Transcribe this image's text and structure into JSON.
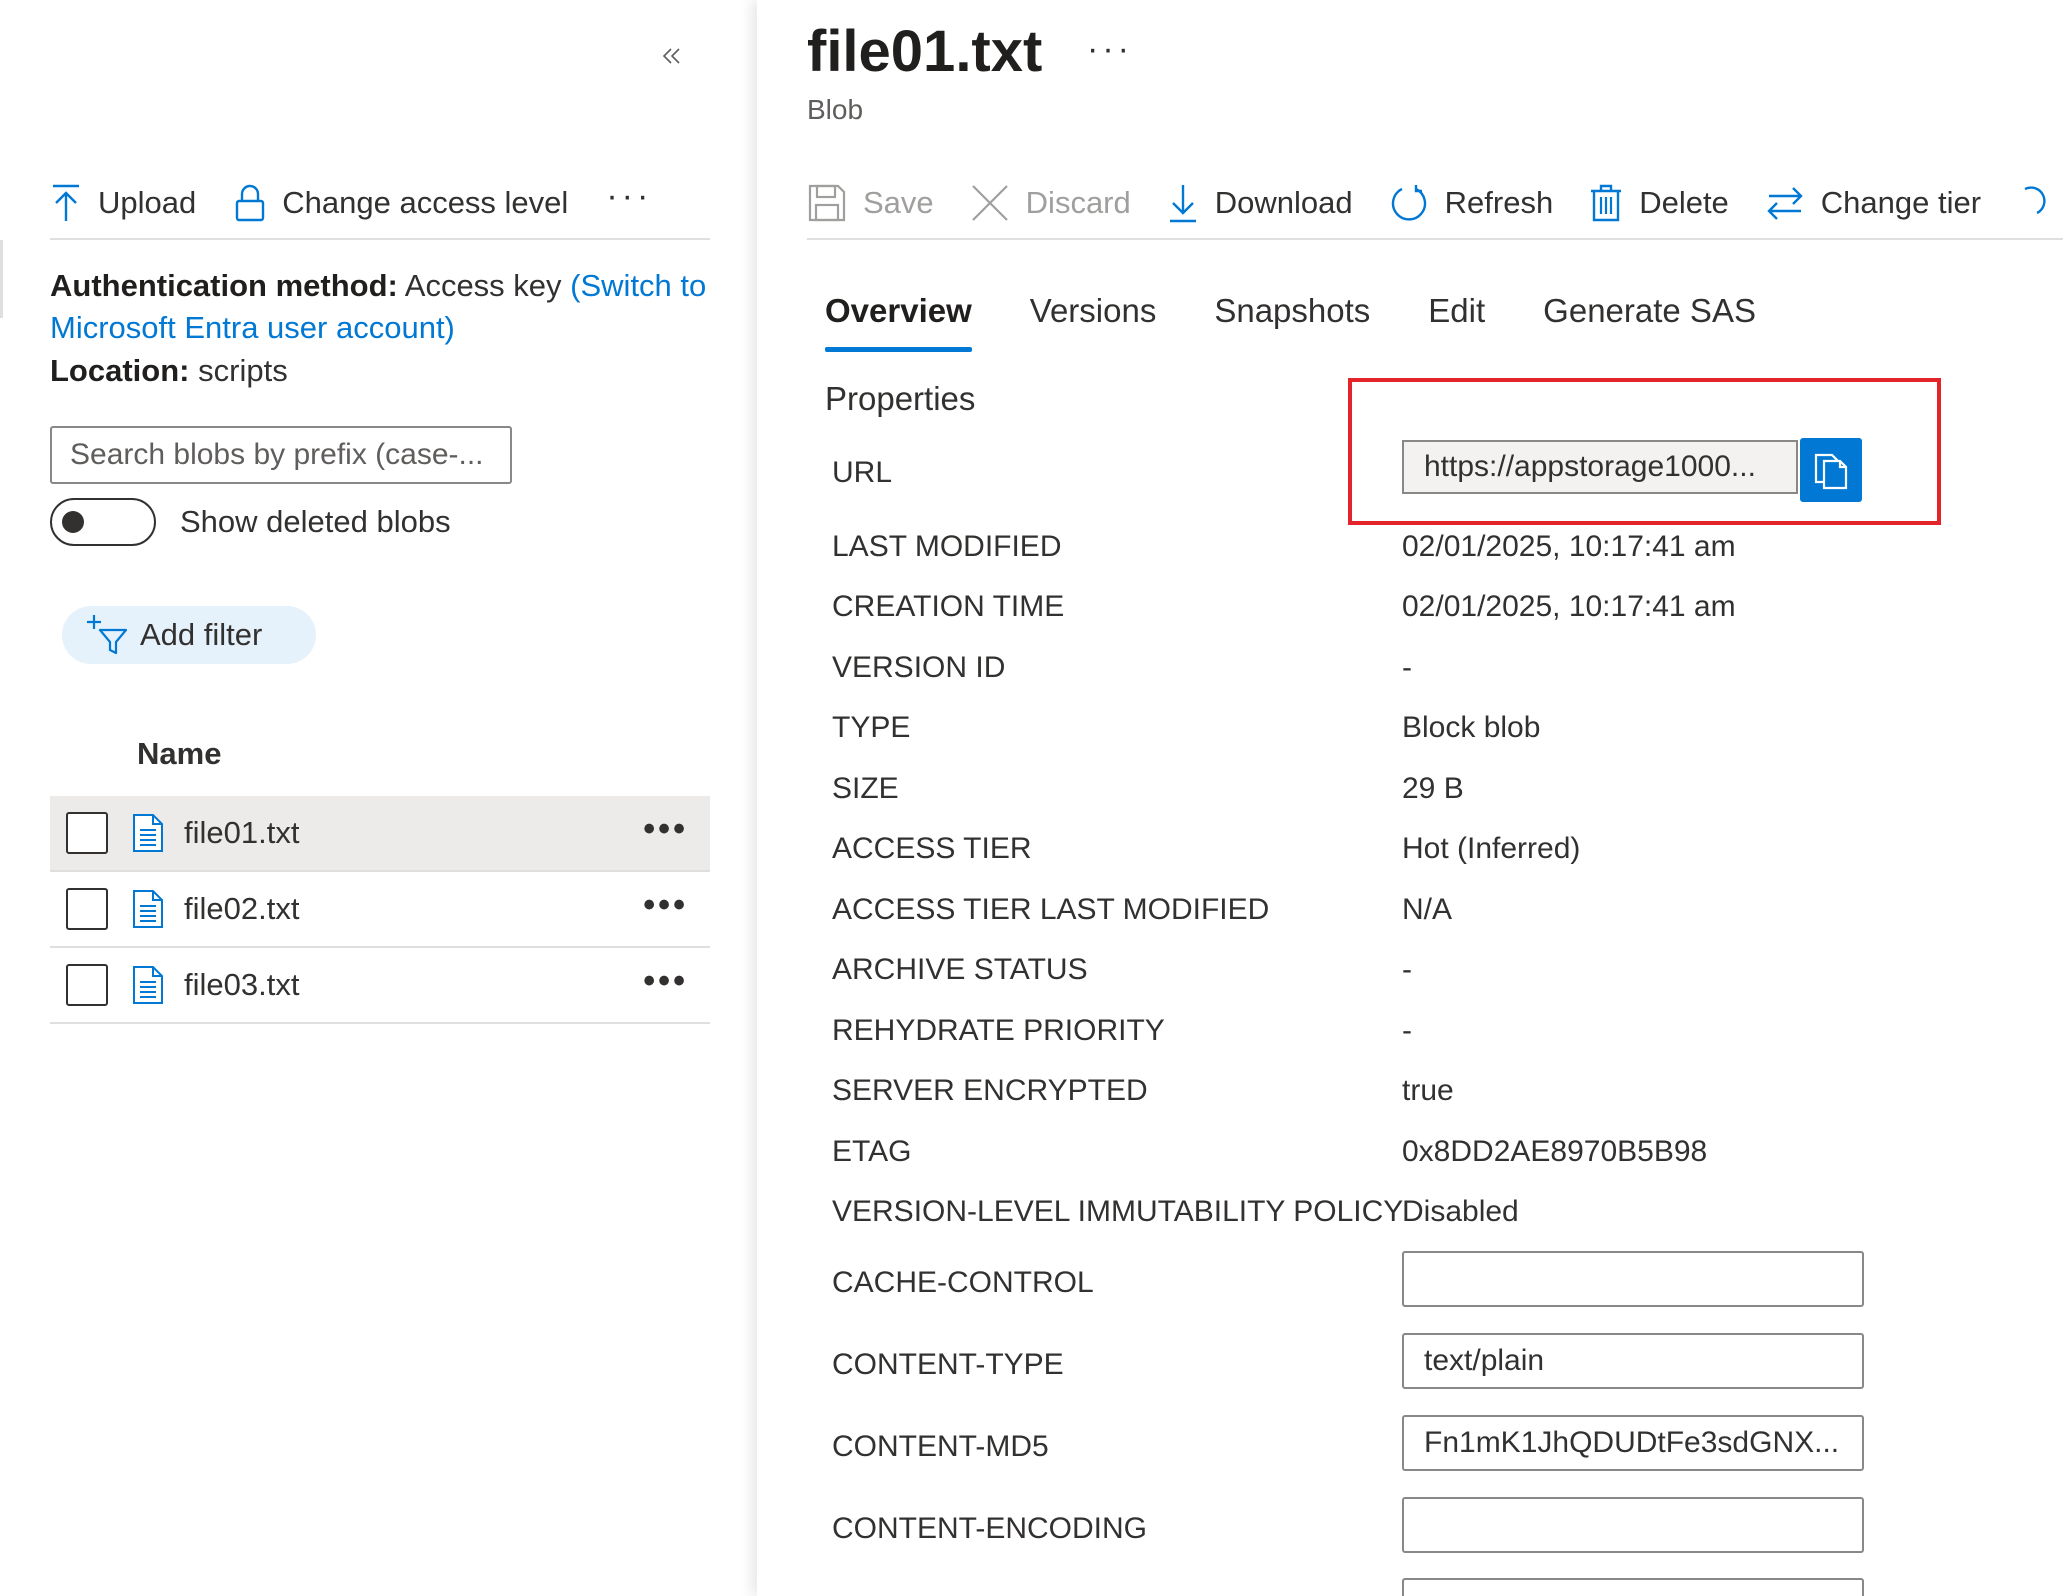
{
  "left": {
    "toolbar": {
      "upload_label": "Upload",
      "change_access_label": "Change access level",
      "more_label": "···"
    },
    "auth": {
      "label": "Authentication method:",
      "value": "Access key",
      "switch_link": "(Switch to Microsoft Entra user account)"
    },
    "location": {
      "label": "Location:",
      "value": "scripts"
    },
    "search": {
      "placeholder": "Search blobs by prefix (case-..."
    },
    "show_deleted_label": "Show deleted blobs",
    "add_filter_label": "Add filter",
    "list": {
      "header": "Name",
      "items": [
        {
          "name": "file01.txt",
          "more": "•••"
        },
        {
          "name": "file02.txt",
          "more": "•••"
        },
        {
          "name": "file03.txt",
          "more": "•••"
        }
      ]
    }
  },
  "right": {
    "title": "file01.txt",
    "title_more": "···",
    "subtitle": "Blob",
    "toolbar": {
      "save_label": "Save",
      "discard_label": "Discard",
      "download_label": "Download",
      "refresh_label": "Refresh",
      "delete_label": "Delete",
      "change_tier_label": "Change tier"
    },
    "tabs": [
      {
        "label": "Overview"
      },
      {
        "label": "Versions"
      },
      {
        "label": "Snapshots"
      },
      {
        "label": "Edit"
      },
      {
        "label": "Generate SAS"
      }
    ],
    "properties_heading": "Properties",
    "url": {
      "label": "URL",
      "value": "https://appstorage1000..."
    },
    "props": [
      {
        "label": "LAST MODIFIED",
        "value": "02/01/2025, 10:17:41 am"
      },
      {
        "label": "CREATION TIME",
        "value": "02/01/2025, 10:17:41 am"
      },
      {
        "label": "VERSION ID",
        "value": "-"
      },
      {
        "label": "TYPE",
        "value": "Block blob"
      },
      {
        "label": "SIZE",
        "value": "29 B"
      },
      {
        "label": "ACCESS TIER",
        "value": "Hot (Inferred)"
      },
      {
        "label": "ACCESS TIER LAST MODIFIED",
        "value": "N/A"
      },
      {
        "label": "ARCHIVE STATUS",
        "value": "-"
      },
      {
        "label": "REHYDRATE PRIORITY",
        "value": "-"
      },
      {
        "label": "SERVER ENCRYPTED",
        "value": "true"
      },
      {
        "label": "ETAG",
        "value": "0x8DD2AE8970B5B98"
      },
      {
        "label": "VERSION-LEVEL IMMUTABILITY POLICY",
        "value": "Disabled"
      }
    ],
    "editable": [
      {
        "label": "CACHE-CONTROL",
        "value": ""
      },
      {
        "label": "CONTENT-TYPE",
        "value": "text/plain"
      },
      {
        "label": "CONTENT-MD5",
        "value": "Fn1mK1JhQDUDtFe3sdGNX..."
      },
      {
        "label": "CONTENT-ENCODING",
        "value": ""
      }
    ]
  },
  "colors": {
    "accent": "#0078d4",
    "highlight": "#e3242b"
  }
}
